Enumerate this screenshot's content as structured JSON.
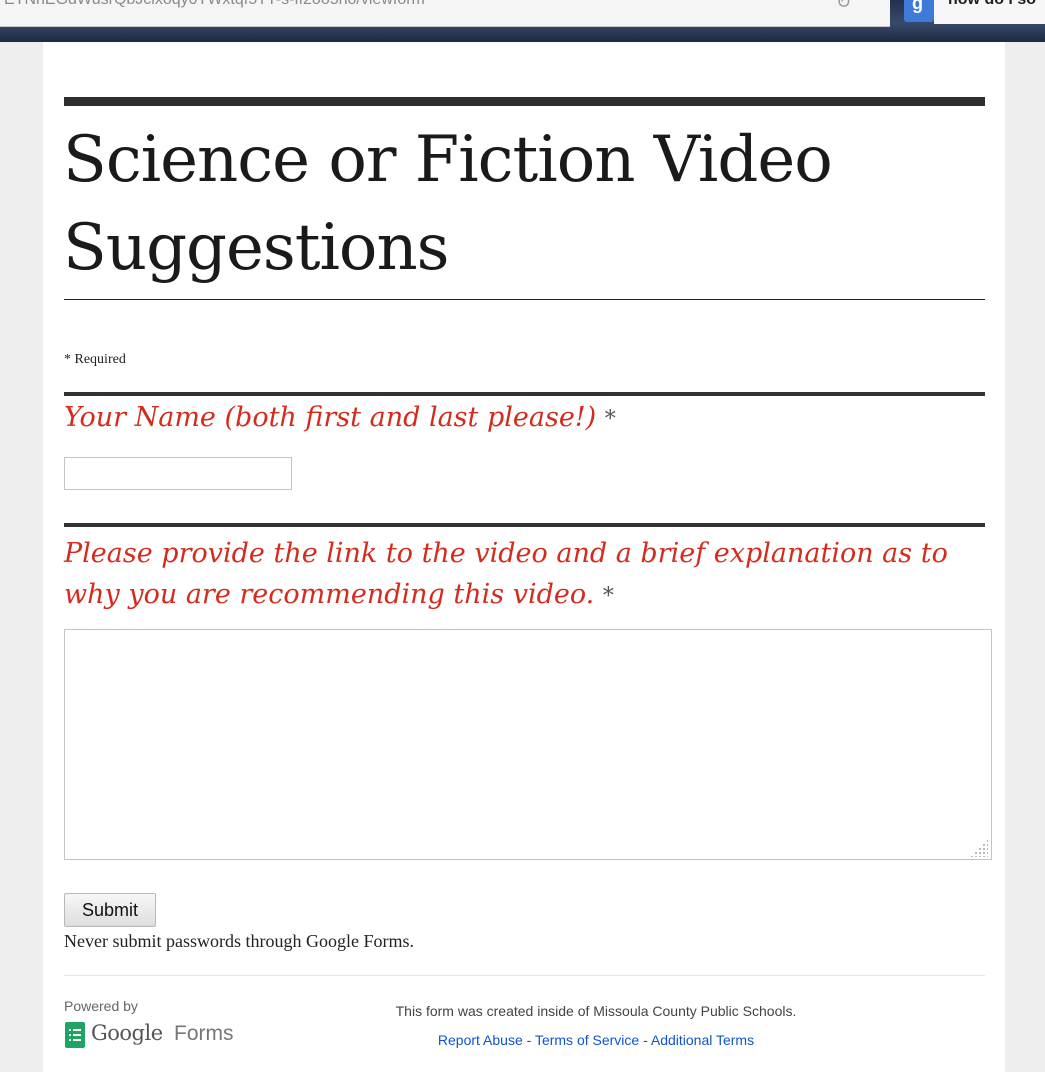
{
  "browser": {
    "url_text": "ETNhEGdWusrQbJclxoqy0TWxtqf5TT-s-ff2oo5no/viewform",
    "reload_glyph": "↻",
    "search_engine_glyph": "g",
    "search_text": "how do i so"
  },
  "form": {
    "title": "Science or Fiction Video Suggestions",
    "required_note": "* Required",
    "questions": [
      {
        "label": "Your Name (both first and last please!)",
        "required_mark": "*",
        "value": ""
      },
      {
        "label": "Please provide the link to the video and a brief explanation as to why you are recommending this video.",
        "required_mark": "*",
        "value": ""
      }
    ],
    "submit_label": "Submit",
    "password_warning": "Never submit passwords through Google Forms."
  },
  "footer": {
    "powered_by": "Powered by",
    "logo_google": "Google",
    "logo_forms": "Forms",
    "created_inside": "This form was created inside of Missoula County Public Schools.",
    "report_abuse": "Report Abuse",
    "terms_of_service": "Terms of Service",
    "additional_terms": "Additional Terms",
    "separator": " - "
  },
  "colors": {
    "question_red": "#d52b1e",
    "link_blue": "#1155cc",
    "forms_green": "#1fa463"
  }
}
